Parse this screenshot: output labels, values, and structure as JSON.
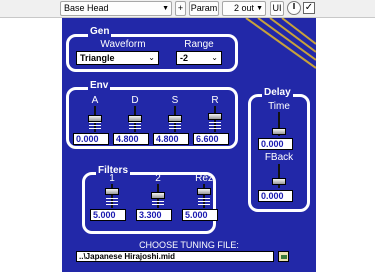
{
  "host": {
    "preset": "Base Head",
    "plus_label": "+",
    "param_label": "Param",
    "output": "2 out",
    "ui_label": "UI",
    "bypass_checked": "✓"
  },
  "gen": {
    "title": "Gen",
    "waveform_label": "Waveform",
    "waveform_value": "Triangle",
    "range_label": "Range",
    "range_value": "-2"
  },
  "env": {
    "title": "Env",
    "sliders": [
      {
        "label": "A",
        "value": "0.000",
        "level": 0.55
      },
      {
        "label": "D",
        "value": "4.800",
        "level": 0.55
      },
      {
        "label": "S",
        "value": "4.800",
        "level": 0.55
      },
      {
        "label": "R",
        "value": "6.600",
        "level": 0.65
      }
    ]
  },
  "delay": {
    "title": "Delay",
    "time_label": "Time",
    "time_value": "0.000",
    "fback_label": "FBack",
    "fback_value": "0.000"
  },
  "filters": {
    "title": "Filters",
    "sliders": [
      {
        "label": "1",
        "value": "5.000",
        "level": 0.75
      },
      {
        "label": "2",
        "value": "3.300",
        "level": 0.55
      },
      {
        "label": "Rez",
        "value": "5.000",
        "level": 0.75
      }
    ]
  },
  "tuning": {
    "label": "CHOOSE TUNING FILE:",
    "file": "..\\Japanese Hirajoshi.mid"
  },
  "colors": {
    "panel_bg": "#2228a8",
    "accent_stripe": "#c8a23a",
    "value_text": "#1a1ab0"
  }
}
